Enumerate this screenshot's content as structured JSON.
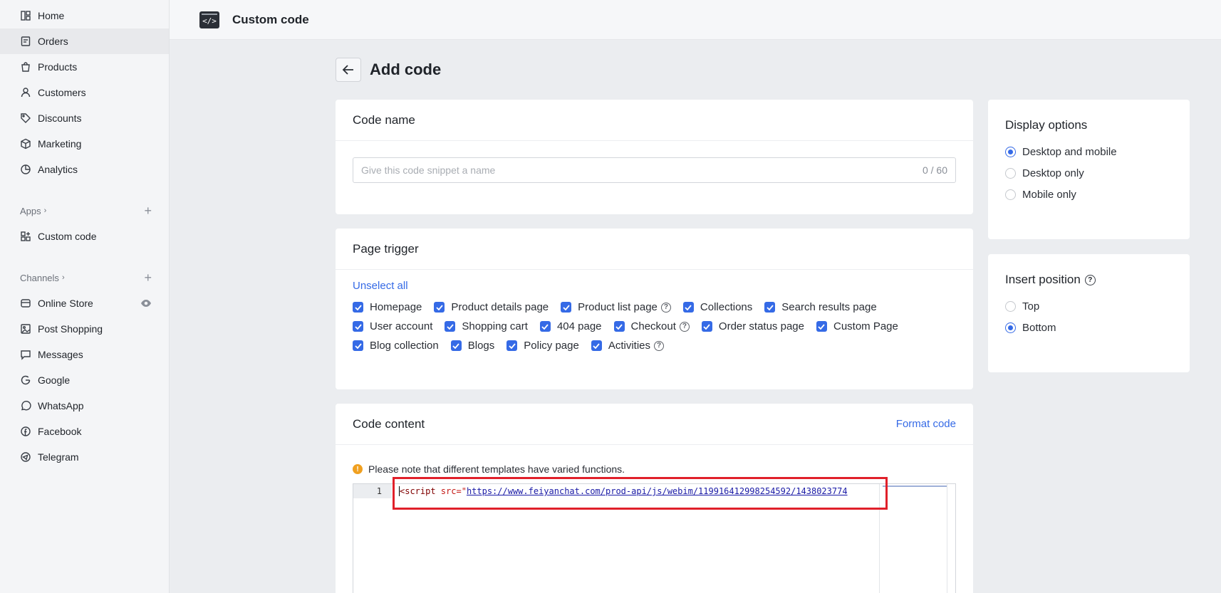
{
  "sidebar": {
    "main": [
      {
        "label": "Home",
        "icon": "home-icon"
      },
      {
        "label": "Orders",
        "icon": "orders-icon"
      },
      {
        "label": "Products",
        "icon": "bag-icon"
      },
      {
        "label": "Customers",
        "icon": "user-icon"
      },
      {
        "label": "Discounts",
        "icon": "tag-icon"
      },
      {
        "label": "Marketing",
        "icon": "cube-icon"
      },
      {
        "label": "Analytics",
        "icon": "pie-icon"
      }
    ],
    "apps_label": "Apps",
    "apps": [
      {
        "label": "Custom code",
        "icon": "grid-icon"
      }
    ],
    "channels_label": "Channels",
    "channels": [
      {
        "label": "Online Store",
        "icon": "store-icon"
      },
      {
        "label": "Post Shopping",
        "icon": "image-icon"
      },
      {
        "label": "Messages",
        "icon": "chat-icon"
      },
      {
        "label": "Google",
        "icon": "google-icon"
      },
      {
        "label": "WhatsApp",
        "icon": "whatsapp-icon"
      },
      {
        "label": "Facebook",
        "icon": "facebook-icon"
      },
      {
        "label": "Telegram",
        "icon": "telegram-icon"
      }
    ]
  },
  "topbar": {
    "logo_text": "</>",
    "title": "Custom code"
  },
  "header": {
    "title": "Add code"
  },
  "code_name": {
    "title": "Code name",
    "placeholder": "Give this code snippet a name",
    "counter": "0 / 60"
  },
  "page_trigger": {
    "title": "Page trigger",
    "unselect_all": "Unselect all",
    "rows": [
      [
        {
          "label": "Homepage"
        },
        {
          "label": "Product details page"
        },
        {
          "label": "Product list page",
          "help": true
        },
        {
          "label": "Collections"
        },
        {
          "label": "Search results page"
        }
      ],
      [
        {
          "label": "User account"
        },
        {
          "label": "Shopping cart"
        },
        {
          "label": "404 page"
        },
        {
          "label": "Checkout",
          "help": true
        },
        {
          "label": "Order status page"
        },
        {
          "label": "Custom Page"
        }
      ],
      [
        {
          "label": "Blog collection"
        },
        {
          "label": "Blogs"
        },
        {
          "label": "Policy page"
        },
        {
          "label": "Activities",
          "help": true
        }
      ]
    ]
  },
  "code_content": {
    "title": "Code content",
    "format_label": "Format code",
    "notice": "Please note that different templates have varied functions.",
    "line_number": "1",
    "code_tag": "<script",
    "code_attr": " src=",
    "code_quote": "\"",
    "code_url": "https://www.feiyanchat.com/prod-api/js/webim/119916412998254592/1438023774"
  },
  "display_options": {
    "title": "Display options",
    "options": [
      {
        "label": "Desktop and mobile",
        "selected": true
      },
      {
        "label": "Desktop only",
        "selected": false
      },
      {
        "label": "Mobile only",
        "selected": false
      }
    ]
  },
  "insert_position": {
    "title": "Insert position",
    "options": [
      {
        "label": "Top",
        "selected": false
      },
      {
        "label": "Bottom",
        "selected": true
      }
    ]
  },
  "colors": {
    "accent": "#356ae6",
    "highlight": "#e0202a",
    "warning": "#f0a020"
  }
}
